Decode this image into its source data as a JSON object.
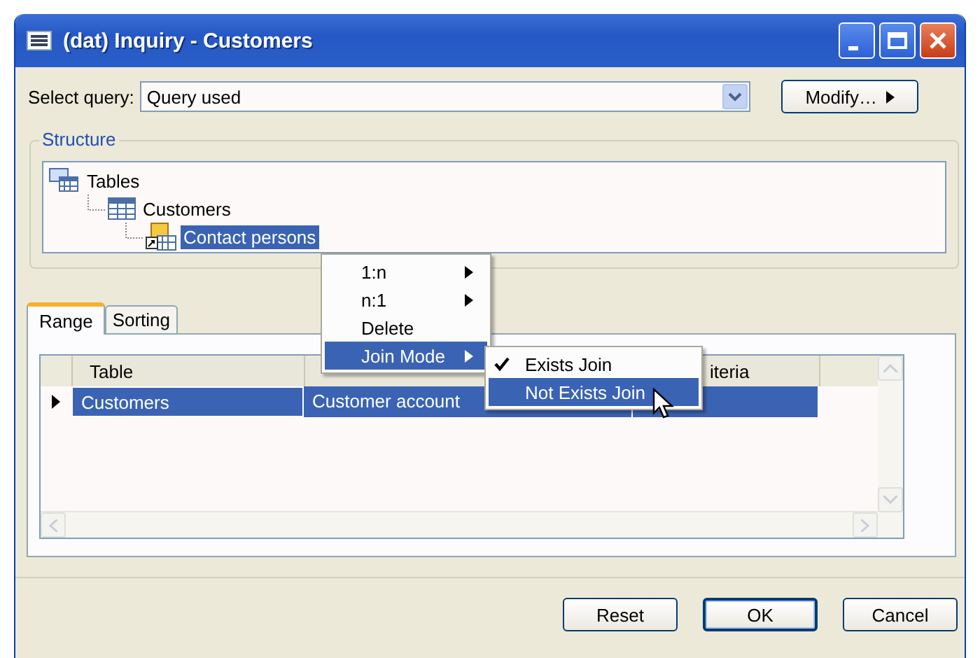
{
  "window": {
    "title": "(dat) Inquiry - Customers"
  },
  "query": {
    "label": "Select query:",
    "value": "Query used",
    "button": "Modify…"
  },
  "structure": {
    "title": "Structure",
    "tree": [
      {
        "label": "Tables",
        "kind": "tables",
        "selected": false,
        "children": [
          {
            "label": "Customers",
            "kind": "table",
            "selected": false,
            "children": [
              {
                "label": "Contact persons",
                "kind": "join",
                "selected": true
              }
            ]
          }
        ]
      }
    ]
  },
  "context_menu": {
    "items": [
      {
        "label": "1:n",
        "submenu": true,
        "selected": false
      },
      {
        "label": "n:1",
        "submenu": true,
        "selected": false
      },
      {
        "label": "Delete",
        "submenu": false,
        "selected": false
      },
      {
        "label": "Join Mode",
        "submenu": true,
        "selected": true
      }
    ]
  },
  "submenu": {
    "items": [
      {
        "label": "Exists Join",
        "checked": true,
        "selected": false
      },
      {
        "label": "Not Exists Join",
        "checked": false,
        "selected": true
      }
    ]
  },
  "tabs": [
    {
      "label": "Range",
      "selected": true
    },
    {
      "label": "Sorting",
      "selected": false
    }
  ],
  "grid": {
    "columns": [
      {
        "label": "Table",
        "covered": false
      },
      {
        "covered": true
      },
      {
        "label": "iteria",
        "covered": false
      }
    ],
    "rows": [
      {
        "current": true,
        "selected": true,
        "cells": [
          "Customers",
          "Customer account"
        ]
      }
    ]
  },
  "buttons": [
    {
      "label": "Reset",
      "default": false
    },
    {
      "label": "OK",
      "default": true
    },
    {
      "label": "Cancel",
      "default": false
    }
  ]
}
